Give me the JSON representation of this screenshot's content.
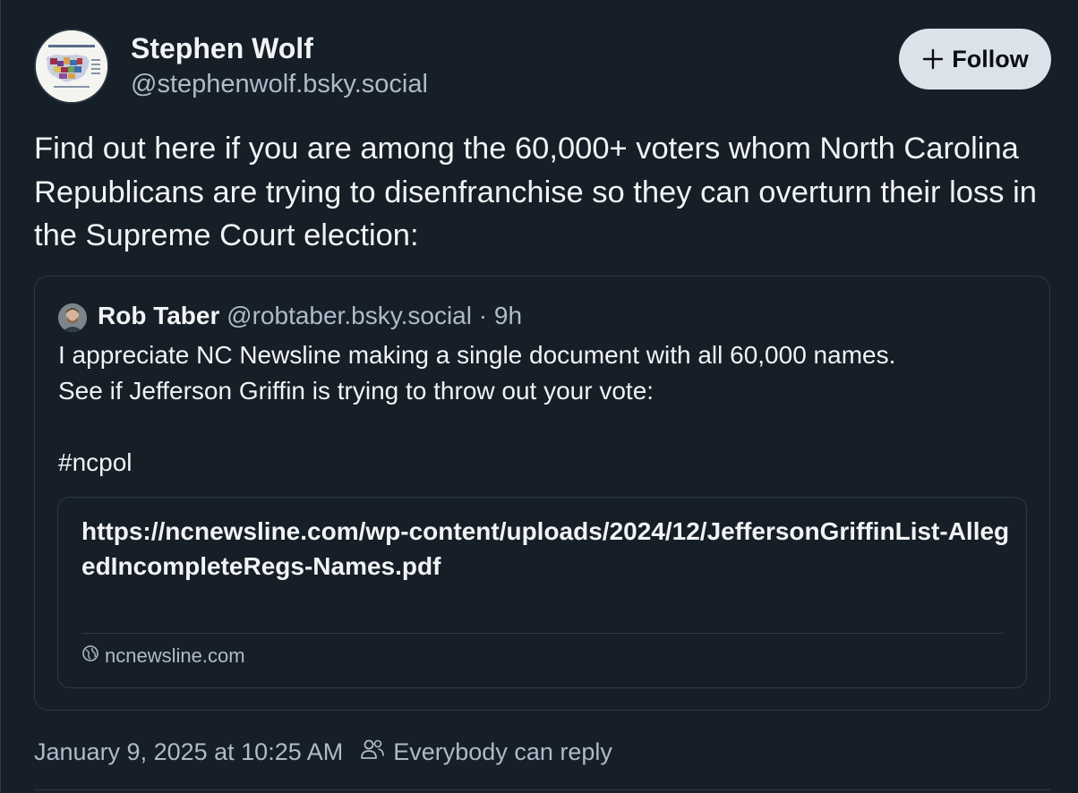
{
  "post": {
    "author_name": "Stephen Wolf",
    "author_handle": "@stephenwolf.bsky.social",
    "follow_label": "Follow",
    "text": "Find out here if you are among the 60,000+ voters whom North Carolina Republicans are trying to disenfranchise so they can overturn their loss in the Supreme Court election:",
    "timestamp": "January 9, 2025 at 10:25 AM",
    "reply_setting": "Everybody can reply"
  },
  "quote": {
    "author_name": "Rob Taber",
    "author_handle": "@robtaber.bsky.social",
    "separator": "·",
    "time_ago": "9h",
    "line1": "I appreciate NC Newsline making a single document with all 60,000 names.",
    "line2": "See if Jefferson Griffin is trying to throw out your vote:",
    "hashtag": "#ncpol",
    "link": {
      "title": "https://ncnewsline.com/wp-content/uploads/2024/12/JeffersonGriffinList-AllegedIncompleteRegs-Names.pdf",
      "domain": "ncnewsline.com"
    }
  },
  "icons": {
    "follow": "plus-icon",
    "domain": "globe-icon",
    "reply": "people-icon"
  },
  "colors": {
    "background": "#161e27",
    "border": "#2e3a48",
    "muted_text": "#aebbc9",
    "follow_button_bg": "#dce2ea"
  }
}
